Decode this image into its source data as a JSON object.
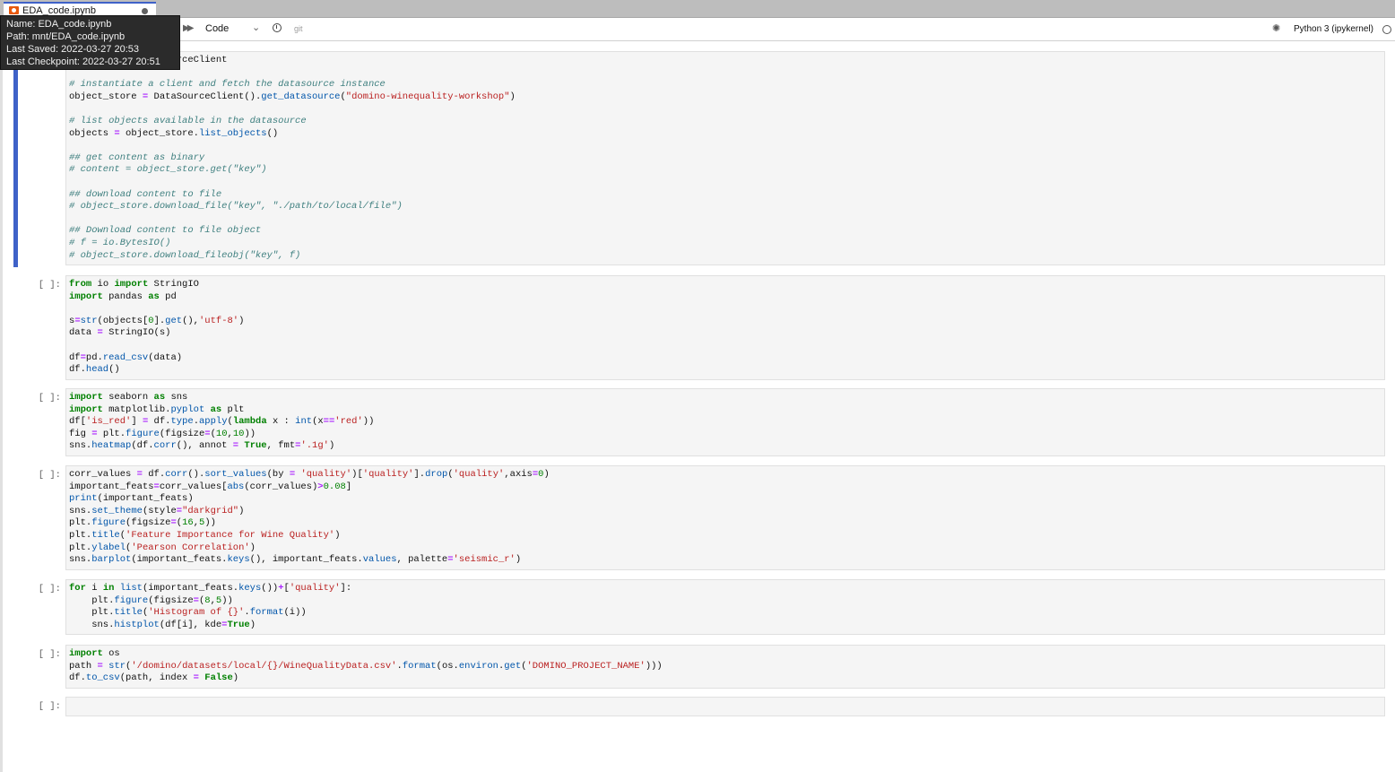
{
  "tab": {
    "title": "EDA_code.ipynb"
  },
  "tooltip": {
    "name": "Name: EDA_code.ipynb",
    "path": "Path: mnt/EDA_code.ipynb",
    "last_saved": "Last Saved: 2022-03-27 20:53",
    "last_checkpoint": "Last Checkpoint: 2022-03-27 20:51"
  },
  "toolbar": {
    "cell_type": "Code",
    "git_label": "git",
    "kernel": "Python 3 (ipykernel)"
  },
  "cells": [
    {
      "prompt": "",
      "lines": [
        "[[{\"t\":\"rces \"},{\"t\":\"import\",\"c\":\"kw\"},{\"t\":\" DataSourceClient\"}]]",
        "",
        "[[{\"t\":\"# instantiate a client and fetch the datasource instance\",\"c\":\"cm\"}]]",
        "[[{\"t\":\"object_store \"},{\"t\":\"=\",\"c\":\"op\"},{\"t\":\" DataSourceClient().\"},{\"t\":\"get_datasource\",\"c\":\"fn\"},{\"t\":\"(\"},{\"t\":\"\\\"domino-winequality-workshop\\\"\",\"c\":\"str\"},{\"t\":\")\"}]]",
        "",
        "[[{\"t\":\"# list objects available in the datasource\",\"c\":\"cm\"}]]",
        "[[{\"t\":\"objects \"},{\"t\":\"=\",\"c\":\"op\"},{\"t\":\" object_store.\"},{\"t\":\"list_objects\",\"c\":\"fn\"},{\"t\":\"()\"}]]",
        "",
        "[[{\"t\":\"## get content as binary\",\"c\":\"cm\"}]]",
        "[[{\"t\":\"# content = object_store.get(\\\"key\\\")\",\"c\":\"cm\"}]]",
        "",
        "[[{\"t\":\"## download content to file\",\"c\":\"cm\"}]]",
        "[[{\"t\":\"# object_store.download_file(\\\"key\\\", \\\"./path/to/local/file\\\")\",\"c\":\"cm\"}]]",
        "",
        "[[{\"t\":\"## Download content to file object\",\"c\":\"cm\"}]]",
        "[[{\"t\":\"# f = io.BytesIO()\",\"c\":\"cm\"}]]",
        "[[{\"t\":\"# object_store.download_fileobj(\\\"key\\\", f)\",\"c\":\"cm\"}]]"
      ]
    },
    {
      "prompt": "[ ]:",
      "lines": [
        "[[{\"t\":\"from\",\"c\":\"kw\"},{\"t\":\" io \"},{\"t\":\"import\",\"c\":\"kw\"},{\"t\":\" StringIO\"}]]",
        "[[{\"t\":\"import\",\"c\":\"kw\"},{\"t\":\" pandas \"},{\"t\":\"as\",\"c\":\"kw\"},{\"t\":\" pd\"}]]",
        "",
        "[[{\"t\":\"s\"},{\"t\":\"=\",\"c\":\"op\"},{\"t\":\"str\",\"c\":\"fn\"},{\"t\":\"(objects[\"},{\"t\":\"0\",\"c\":\"num\"},{\"t\":\"].\"},{\"t\":\"get\",\"c\":\"fn\"},{\"t\":\"(),\"},{\"t\":\"'utf-8'\",\"c\":\"str\"},{\"t\":\")\"}]]",
        "[[{\"t\":\"data \"},{\"t\":\"=\",\"c\":\"op\"},{\"t\":\" StringIO(s)\"}]]",
        "",
        "[[{\"t\":\"df\"},{\"t\":\"=\",\"c\":\"op\"},{\"t\":\"pd.\"},{\"t\":\"read_csv\",\"c\":\"fn\"},{\"t\":\"(data)\"}]]",
        "[[{\"t\":\"df.\"},{\"t\":\"head\",\"c\":\"fn\"},{\"t\":\"()\"}]]"
      ]
    },
    {
      "prompt": "[ ]:",
      "lines": [
        "[[{\"t\":\"import\",\"c\":\"kw\"},{\"t\":\" seaborn \"},{\"t\":\"as\",\"c\":\"kw\"},{\"t\":\" sns\"}]]",
        "[[{\"t\":\"import\",\"c\":\"kw\"},{\"t\":\" matplotlib.\"},{\"t\":\"pyplot\",\"c\":\"fn\"},{\"t\":\" \"},{\"t\":\"as\",\"c\":\"kw\"},{\"t\":\" plt\"}]]",
        "[[{\"t\":\"df[\"},{\"t\":\"'is_red'\",\"c\":\"str\"},{\"t\":\"] \"},{\"t\":\"=\",\"c\":\"op\"},{\"t\":\" df.\"},{\"t\":\"type\",\"c\":\"fn\"},{\"t\":\".\"},{\"t\":\"apply\",\"c\":\"fn\"},{\"t\":\"(\"},{\"t\":\"lambda\",\"c\":\"kw\"},{\"t\":\" x : \"},{\"t\":\"int\",\"c\":\"fn\"},{\"t\":\"(x\"},{\"t\":\"==\",\"c\":\"op\"},{\"t\":\"'red'\",\"c\":\"str\"},{\"t\":\"))\"}]]",
        "[[{\"t\":\"fig \"},{\"t\":\"=\",\"c\":\"op\"},{\"t\":\" plt.\"},{\"t\":\"figure\",\"c\":\"fn\"},{\"t\":\"(figsize\"},{\"t\":\"=\",\"c\":\"op\"},{\"t\":\"(\"},{\"t\":\"10\",\"c\":\"num\"},{\"t\":\",\"},{\"t\":\"10\",\"c\":\"num\"},{\"t\":\"))\"}]]",
        "[[{\"t\":\"sns.\"},{\"t\":\"heatmap\",\"c\":\"fn\"},{\"t\":\"(df.\"},{\"t\":\"corr\",\"c\":\"fn\"},{\"t\":\"(), annot \"},{\"t\":\"=\",\"c\":\"op\"},{\"t\":\" \"},{\"t\":\"True\",\"c\":\"kw\"},{\"t\":\", fmt\"},{\"t\":\"=\",\"c\":\"op\"},{\"t\":\"'.1g'\",\"c\":\"str\"},{\"t\":\")\"}]]"
      ]
    },
    {
      "prompt": "[ ]:",
      "lines": [
        "[[{\"t\":\"corr_values \"},{\"t\":\"=\",\"c\":\"op\"},{\"t\":\" df.\"},{\"t\":\"corr\",\"c\":\"fn\"},{\"t\":\"().\"},{\"t\":\"sort_values\",\"c\":\"fn\"},{\"t\":\"(by \"},{\"t\":\"=\",\"c\":\"op\"},{\"t\":\" \"},{\"t\":\"'quality'\",\"c\":\"str\"},{\"t\":\")[\"},{\"t\":\"'quality'\",\"c\":\"str\"},{\"t\":\"].\"},{\"t\":\"drop\",\"c\":\"fn\"},{\"t\":\"(\"},{\"t\":\"'quality'\",\"c\":\"str\"},{\"t\":\",axis\"},{\"t\":\"=\",\"c\":\"op\"},{\"t\":\"0\",\"c\":\"num\"},{\"t\":\")\"}]]",
        "[[{\"t\":\"important_feats\"},{\"t\":\"=\",\"c\":\"op\"},{\"t\":\"corr_values[\"},{\"t\":\"abs\",\"c\":\"fn\"},{\"t\":\"(corr_values)\"},{\"t\":\">\",\"c\":\"op\"},{\"t\":\"0.08\",\"c\":\"num\"},{\"t\":\"]\"}]]",
        "[[{\"t\":\"print\",\"c\":\"fn\"},{\"t\":\"(important_feats)\"}]]",
        "[[{\"t\":\"sns.\"},{\"t\":\"set_theme\",\"c\":\"fn\"},{\"t\":\"(style\"},{\"t\":\"=\",\"c\":\"op\"},{\"t\":\"\\\"darkgrid\\\"\",\"c\":\"str\"},{\"t\":\")\"}]]",
        "[[{\"t\":\"plt.\"},{\"t\":\"figure\",\"c\":\"fn\"},{\"t\":\"(figsize\"},{\"t\":\"=\",\"c\":\"op\"},{\"t\":\"(\"},{\"t\":\"16\",\"c\":\"num\"},{\"t\":\",\"},{\"t\":\"5\",\"c\":\"num\"},{\"t\":\"))\"}]]",
        "[[{\"t\":\"plt.\"},{\"t\":\"title\",\"c\":\"fn\"},{\"t\":\"(\"},{\"t\":\"'Feature Importance for Wine Quality'\",\"c\":\"str\"},{\"t\":\")\"}]]",
        "[[{\"t\":\"plt.\"},{\"t\":\"ylabel\",\"c\":\"fn\"},{\"t\":\"(\"},{\"t\":\"'Pearson Correlation'\",\"c\":\"str\"},{\"t\":\")\"}]]",
        "[[{\"t\":\"sns.\"},{\"t\":\"barplot\",\"c\":\"fn\"},{\"t\":\"(important_feats.\"},{\"t\":\"keys\",\"c\":\"fn\"},{\"t\":\"(), important_feats.\"},{\"t\":\"values\",\"c\":\"fn\"},{\"t\":\", palette\"},{\"t\":\"=\",\"c\":\"op\"},{\"t\":\"'seismic_r'\",\"c\":\"str\"},{\"t\":\")\"}]]"
      ]
    },
    {
      "prompt": "[ ]:",
      "lines": [
        "[[{\"t\":\"for\",\"c\":\"kw\"},{\"t\":\" i \"},{\"t\":\"in\",\"c\":\"kw\"},{\"t\":\" \"},{\"t\":\"list\",\"c\":\"fn\"},{\"t\":\"(important_feats.\"},{\"t\":\"keys\",\"c\":\"fn\"},{\"t\":\"())\"},{\"t\":\"+\",\"c\":\"op\"},{\"t\":\"[\"},{\"t\":\"'quality'\",\"c\":\"str\"},{\"t\":\"]:\"}]]",
        "[[{\"t\":\"    plt.\"},{\"t\":\"figure\",\"c\":\"fn\"},{\"t\":\"(figsize\"},{\"t\":\"=\",\"c\":\"op\"},{\"t\":\"(\"},{\"t\":\"8\",\"c\":\"num\"},{\"t\":\",\"},{\"t\":\"5\",\"c\":\"num\"},{\"t\":\"))\"}]]",
        "[[{\"t\":\"    plt.\"},{\"t\":\"title\",\"c\":\"fn\"},{\"t\":\"(\"},{\"t\":\"'Histogram of {}'\",\"c\":\"str\"},{\"t\":\".\"},{\"t\":\"format\",\"c\":\"fn\"},{\"t\":\"(i))\"}]]",
        "[[{\"t\":\"    sns.\"},{\"t\":\"histplot\",\"c\":\"fn\"},{\"t\":\"(df[i], kde\"},{\"t\":\"=\",\"c\":\"op\"},{\"t\":\"True\",\"c\":\"kw\"},{\"t\":\")\"}]]"
      ]
    },
    {
      "prompt": "[ ]:",
      "lines": [
        "[[{\"t\":\"import\",\"c\":\"kw\"},{\"t\":\" os\"}]]",
        "[[{\"t\":\"path \"},{\"t\":\"=\",\"c\":\"op\"},{\"t\":\" \"},{\"t\":\"str\",\"c\":\"fn\"},{\"t\":\"(\"},{\"t\":\"'/domino/datasets/local/{}/WineQualityData.csv'\",\"c\":\"str\"},{\"t\":\".\"},{\"t\":\"format\",\"c\":\"fn\"},{\"t\":\"(os.\"},{\"t\":\"environ\",\"c\":\"fn\"},{\"t\":\".\"},{\"t\":\"get\",\"c\":\"fn\"},{\"t\":\"(\"},{\"t\":\"'DOMINO_PROJECT_NAME'\",\"c\":\"str\"},{\"t\":\")))\"}]]",
        "[[{\"t\":\"df.\"},{\"t\":\"to_csv\",\"c\":\"fn\"},{\"t\":\"(path, index \"},{\"t\":\"=\",\"c\":\"op\"},{\"t\":\" \"},{\"t\":\"False\",\"c\":\"kw\"},{\"t\":\")\"}]]"
      ]
    },
    {
      "prompt": "[ ]:",
      "lines": [
        ""
      ]
    }
  ]
}
